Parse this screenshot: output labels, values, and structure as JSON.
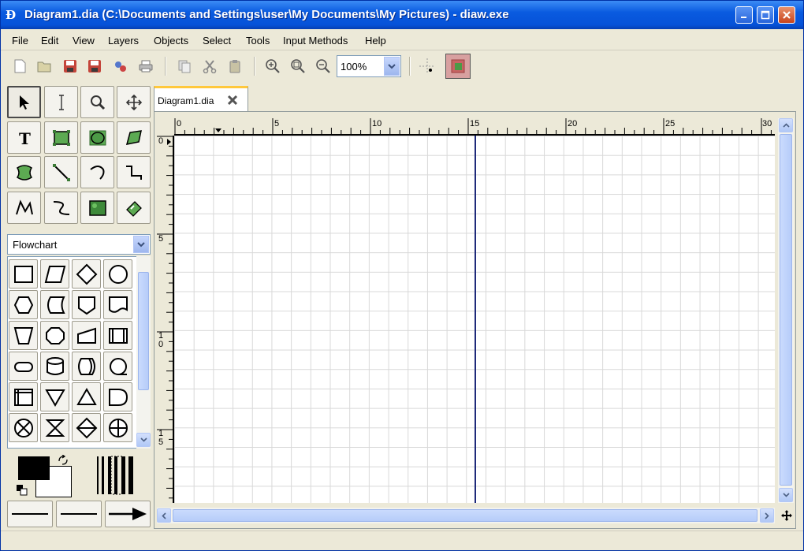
{
  "window": {
    "title": "Diagram1.dia (C:\\Documents and Settings\\user\\My Documents\\My Pictures) - diaw.exe",
    "app_icon_glyph": "Ð",
    "controls": [
      "minimize",
      "maximize",
      "close"
    ]
  },
  "menu": [
    {
      "label": "File"
    },
    {
      "label": "Edit"
    },
    {
      "label": "View"
    },
    {
      "label": "Layers"
    },
    {
      "label": "Objects"
    },
    {
      "label": "Select"
    },
    {
      "label": "Tools"
    },
    {
      "label": "Input Methods"
    },
    {
      "label": "Help"
    }
  ],
  "toolbar": {
    "buttons": [
      "new-icon",
      "open-icon",
      "save-icon",
      "save-as-icon",
      "export-icon",
      "print-icon",
      "copy-icon",
      "cut-icon",
      "paste-icon",
      "zoom-in-icon",
      "zoom-fit-icon",
      "zoom-out-icon",
      "snap-grid-icon",
      "snap-object-icon"
    ],
    "zoom_value": "100%"
  },
  "tools": [
    "pointer-icon",
    "text-edit-icon",
    "magnify-icon",
    "scroll-icon",
    "text-icon",
    "box-icon",
    "ellipse-icon",
    "polygon-icon",
    "beziergon-icon",
    "line-icon",
    "arc-icon",
    "zigzag-icon",
    "polyline-icon",
    "bezier-icon",
    "image-icon",
    "outline-icon"
  ],
  "sheet": {
    "selected": "Flowchart",
    "shapes": [
      "process",
      "data",
      "decision",
      "connector",
      "preparation",
      "stored-data",
      "offpage",
      "document",
      "manual-operation",
      "terminal-alt",
      "manual-input",
      "predefined-process",
      "terminal",
      "magnetic-disk",
      "direct-access",
      "sequential-access",
      "internal-storage",
      "merge",
      "extract",
      "delay",
      "summing-junction",
      "collate",
      "sort",
      "or"
    ]
  },
  "colors": {
    "foreground": "#000000",
    "background": "#FFFFFF",
    "guide": "#1E2A7A",
    "accent_tab": "#FFC83C"
  },
  "tab": {
    "label": "Diagram1.dia"
  },
  "ruler": {
    "h_labels": [
      "0",
      "5",
      "10",
      "15",
      "20",
      "25",
      "30"
    ],
    "v_labels": [
      "0",
      "5",
      "1\n0",
      "1\n5"
    ]
  }
}
